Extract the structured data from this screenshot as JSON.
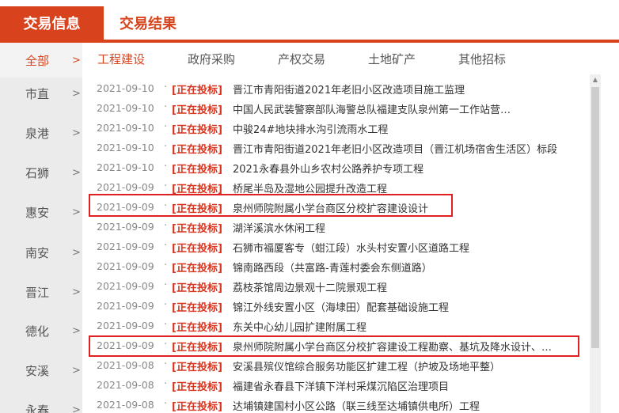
{
  "tabs": {
    "active": "交易信息",
    "other": "交易结果"
  },
  "sidebar": {
    "items": [
      {
        "label": "全部",
        "arrow": ">"
      },
      {
        "label": "市直",
        "arrow": ">"
      },
      {
        "label": "泉港",
        "arrow": ">"
      },
      {
        "label": "石狮",
        "arrow": ">"
      },
      {
        "label": "惠安",
        "arrow": ">"
      },
      {
        "label": "南安",
        "arrow": ">"
      },
      {
        "label": "晋江",
        "arrow": ">"
      },
      {
        "label": "德化",
        "arrow": ">"
      },
      {
        "label": "安溪",
        "arrow": ">"
      },
      {
        "label": "永春",
        "arrow": ">"
      }
    ]
  },
  "categories": [
    "工程建设",
    "政府采购",
    "产权交易",
    "土地矿产",
    "其他招标"
  ],
  "list": {
    "dot": "·",
    "rows": [
      {
        "date": "2021-09-10",
        "status": "[正在投标]",
        "title": "晋江市青阳街道2021年老旧小区改造项目施工监理"
      },
      {
        "date": "2021-09-10",
        "status": "[正在投标]",
        "title": "中国人民武装警察部队海警总队福建支队泉州第一工作站营…"
      },
      {
        "date": "2021-09-10",
        "status": "[正在投标]",
        "title": "中骏24#地块排水沟引流雨水工程"
      },
      {
        "date": "2021-09-10",
        "status": "[正在投标]",
        "title": "晋江市青阳街道2021年老旧小区改造项目（晋江机场宿舍生活区）标段"
      },
      {
        "date": "2021-09-10",
        "status": "[正在投标]",
        "title": "2021永春县外山乡农村公路养护专项工程"
      },
      {
        "date": "2021-09-09",
        "status": "[正在投标]",
        "title": "桥尾半岛及湿地公园提升改造工程"
      },
      {
        "date": "2021-09-09",
        "status": "[正在投标]",
        "title": "泉州师院附属小学台商区分校扩容建设设计"
      },
      {
        "date": "2021-09-09",
        "status": "[正在投标]",
        "title": "湖洋溪滨水休闲工程"
      },
      {
        "date": "2021-09-09",
        "status": "[正在投标]",
        "title": "石狮市福厦客专（蚶江段）水头村安置小区道路工程"
      },
      {
        "date": "2021-09-09",
        "status": "[正在投标]",
        "title": "锦南路西段（共富路-青莲村委会东侧道路）"
      },
      {
        "date": "2021-09-09",
        "status": "[正在投标]",
        "title": "荔枝茶馆周边景观十二院景观工程"
      },
      {
        "date": "2021-09-09",
        "status": "[正在投标]",
        "title": "锦江外线安置小区（海埭田）配套基础设施工程"
      },
      {
        "date": "2021-09-09",
        "status": "[正在投标]",
        "title": "东关中心幼儿园扩建附属工程"
      },
      {
        "date": "2021-09-09",
        "status": "[正在投标]",
        "title": "泉州师院附属小学台商区分校扩容建设工程勘察、基坑及降水设计、…"
      },
      {
        "date": "2021-09-08",
        "status": "[正在投标]",
        "title": "安溪县殡仪馆综合服务功能区扩建工程（护坡及场地平整）"
      },
      {
        "date": "2021-09-08",
        "status": "[正在投标]",
        "title": "福建省永春县下洋镇下洋村采煤沉陷区治理项目"
      },
      {
        "date": "2021-09-08",
        "status": "[正在投标]",
        "title": "达埔镇建国村小区公路（联三线至达埔镇供电所）工程"
      }
    ]
  },
  "scrollbar": {
    "up_glyph": "▲"
  },
  "colors": {
    "accent": "#d8431e",
    "status": "#d8341e",
    "highlight": "#e02020"
  }
}
